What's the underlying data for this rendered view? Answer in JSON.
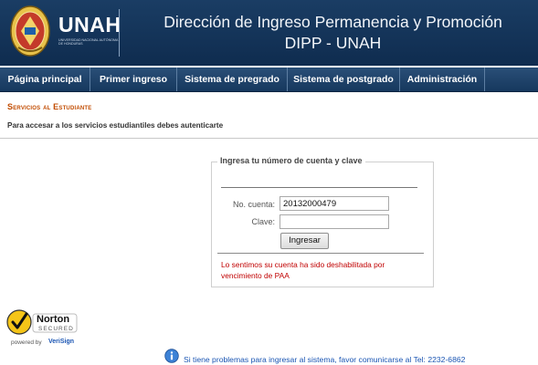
{
  "header": {
    "brand": "UNAH",
    "brand_sub": "UNIVERSIDAD NACIONAL AUTÓNOMA DE HONDURAS",
    "title_line1": "Dirección de Ingreso Permanencia y Promoción",
    "title_line2": "DIPP - UNAH",
    "colors": {
      "header_bg": "#173a60",
      "nav_bg": "#1f4670"
    }
  },
  "nav": {
    "items": [
      {
        "label": "Página principal"
      },
      {
        "label": "Primer ingreso"
      },
      {
        "label": "Sistema de pregrado"
      },
      {
        "label": "Sistema de postgrado"
      },
      {
        "label": "Administración"
      }
    ]
  },
  "section": {
    "title": "Servicios al Estudiante",
    "description": "Para accesar a los servicios estudiantiles debes autenticarte",
    "accent_color": "#c14b00"
  },
  "login": {
    "legend": "Ingresa tu número de cuenta y clave",
    "account_label": "No. cuenta:",
    "account_value": "20132000479",
    "password_label": "Clave:",
    "password_value": "",
    "submit_label": "Ingresar",
    "error_message": "Lo sentimos su cuenta ha sido deshabilitada por vencimiento de PAA",
    "error_color": "#c00000"
  },
  "badge": {
    "brand": "Norton",
    "secured": "SECURED",
    "powered_by": "powered by",
    "provider": "VeriSign",
    "icon": "norton-checkmark-icon"
  },
  "footer": {
    "icon": "info-icon",
    "message": "Si tiene problemas para ingresar al sistema, favor comunicarse al Tel: 2232-6862"
  }
}
